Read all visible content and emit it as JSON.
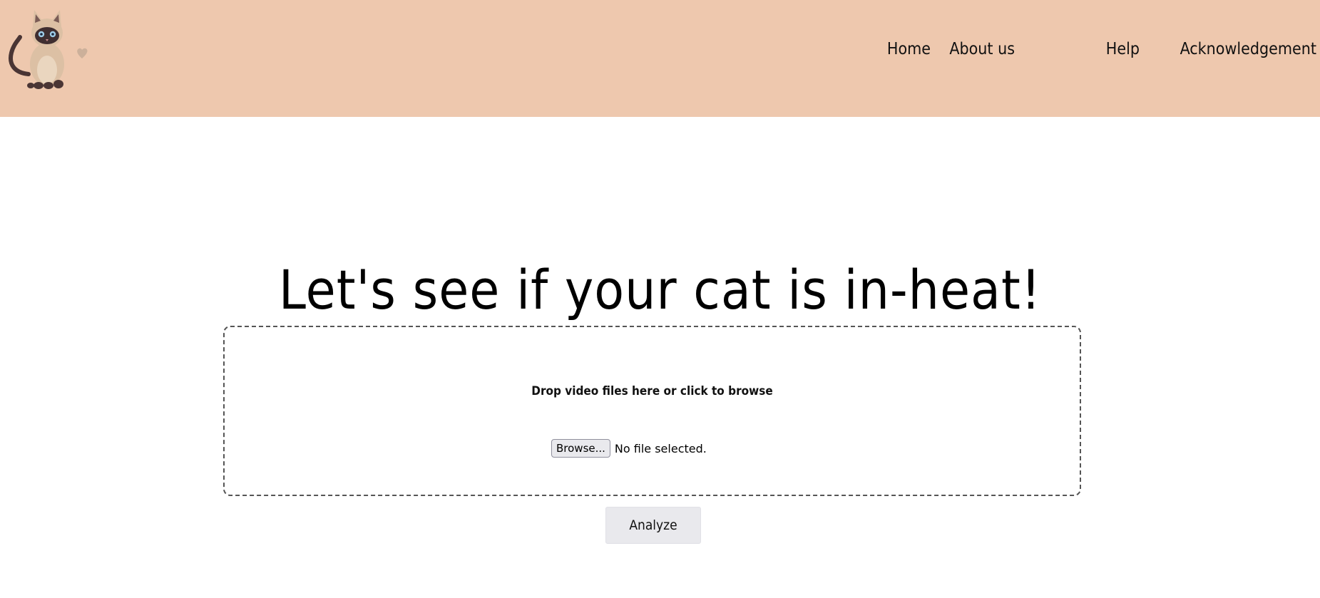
{
  "header": {
    "background": "#eec8ae",
    "logo_icon": "siamese-cat-logo-icon",
    "nav": [
      {
        "label": "Home"
      },
      {
        "label": "About us"
      },
      {
        "label": "Help"
      },
      {
        "label": "Acknowledgement"
      }
    ]
  },
  "main": {
    "headline": "Let's see if your cat is in-heat!",
    "dropzone": {
      "prompt": "Drop video files here or click to browse",
      "browse_label": "Browse...",
      "file_status": "No file selected."
    },
    "analyze_label": "Analyze"
  }
}
